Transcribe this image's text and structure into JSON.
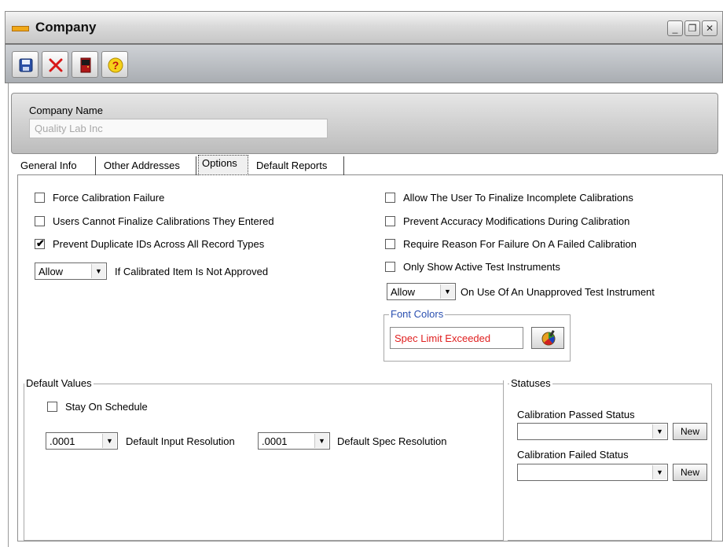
{
  "window": {
    "title": "Company"
  },
  "window_controls": {
    "minimize": "_",
    "restore": "❐",
    "close": "✕"
  },
  "toolbar": [
    {
      "name": "save-button",
      "icon": "save-icon"
    },
    {
      "name": "delete-button",
      "icon": "close-icon"
    },
    {
      "name": "exit-button",
      "icon": "door-icon"
    },
    {
      "name": "help-button",
      "icon": "help-icon"
    }
  ],
  "company": {
    "label": "Company Name",
    "value": "Quality Lab Inc"
  },
  "tabs": [
    "General Info",
    "Other Addresses",
    "Options",
    "Default Reports"
  ],
  "active_tab": "Options",
  "options": {
    "left": [
      {
        "label": "Force Calibration Failure",
        "checked": false
      },
      {
        "label": "Users Cannot Finalize Calibrations They Entered",
        "checked": false
      },
      {
        "label": "Prevent Duplicate IDs Across All Record Types",
        "checked": true
      }
    ],
    "right": [
      {
        "label": "Allow The User To Finalize Incomplete Calibrations",
        "checked": false
      },
      {
        "label": "Prevent Accuracy Modifications During Calibration",
        "checked": false
      },
      {
        "label": "Require Reason For Failure On A Failed Calibration",
        "checked": false
      },
      {
        "label": "Only Show Active Test Instruments",
        "checked": false
      }
    ],
    "not_approved": {
      "value": "Allow",
      "label": "If Calibrated Item Is Not Approved"
    },
    "unapproved_instrument": {
      "value": "Allow",
      "label": "On Use Of An Unapproved Test Instrument"
    },
    "font_colors": {
      "legend": "Font Colors",
      "sample": "Spec Limit Exceeded",
      "sample_color": "#e02020"
    }
  },
  "default_values": {
    "legend": "Default Values",
    "stay_on_schedule": {
      "label": "Stay On Schedule",
      "checked": false
    },
    "input_resolution": {
      "value": ".0001",
      "label": "Default Input Resolution"
    },
    "spec_resolution": {
      "value": ".0001",
      "label": "Default Spec Resolution"
    }
  },
  "statuses": {
    "legend": "Statuses",
    "passed": {
      "label": "Calibration Passed Status",
      "value": "",
      "button": "New"
    },
    "failed": {
      "label": "Calibration Failed Status",
      "value": "",
      "button": "New"
    }
  },
  "arrow_glyph": "▼"
}
